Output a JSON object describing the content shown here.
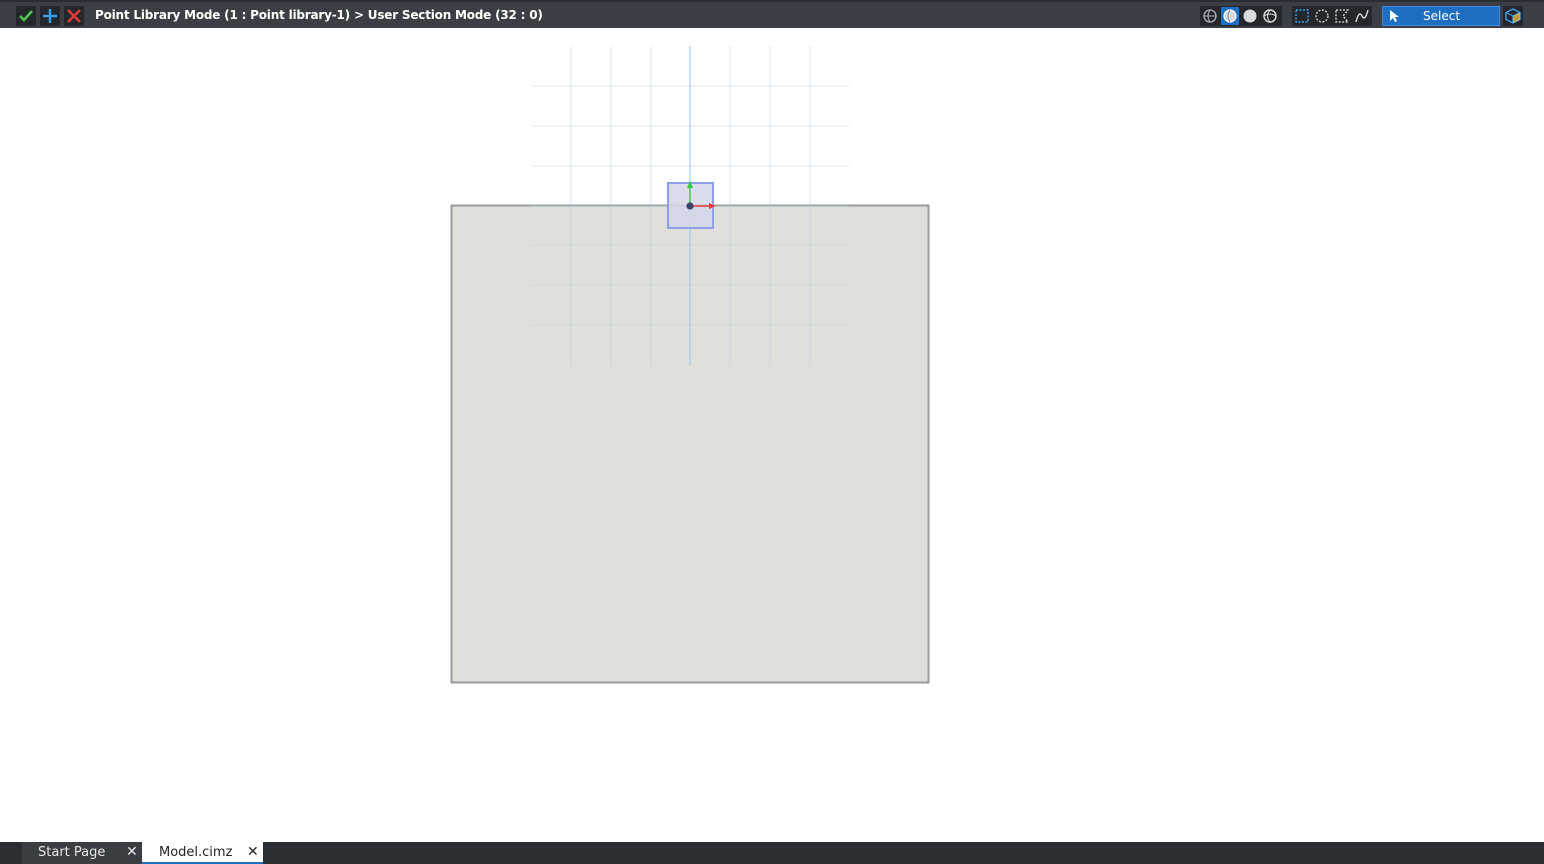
{
  "toolbar": {
    "confirm_icon": "check-icon",
    "add_icon": "plus-icon",
    "cancel_icon": "close-icon",
    "mode_title": "Point Library Mode (1 : Point library-1) > User Section Mode (32 : 0)",
    "select_label": "Select",
    "accent_color": "#1e6fc2"
  },
  "tabs": [
    {
      "label": "Start Page",
      "active": false
    },
    {
      "label": "Model.cimz",
      "active": true
    }
  ],
  "tab_close_glyph": "✕"
}
